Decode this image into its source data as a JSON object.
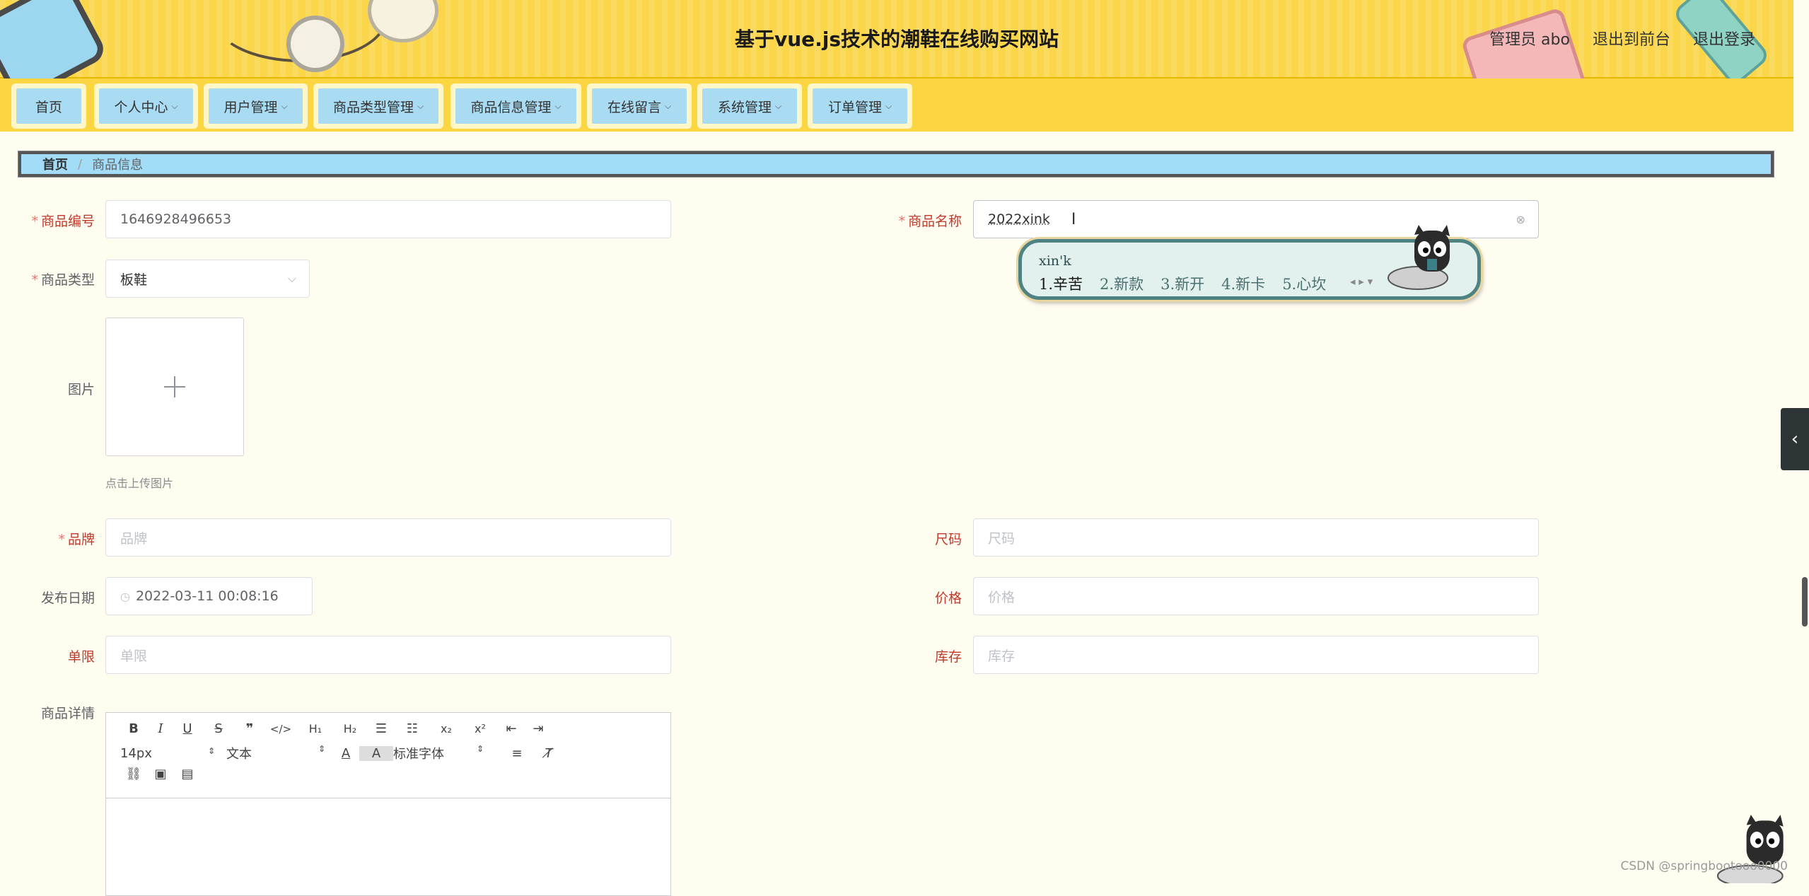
{
  "header": {
    "site_title": "基于vue.js技术的潮鞋在线购买网站",
    "admin_label": "管理员 abo",
    "to_front": "退出到前台",
    "logout": "退出登录"
  },
  "nav": {
    "items": [
      {
        "label": "首页"
      },
      {
        "label": "个人中心"
      },
      {
        "label": "用户管理"
      },
      {
        "label": "商品类型管理"
      },
      {
        "label": "商品信息管理"
      },
      {
        "label": "在线留言"
      },
      {
        "label": "系统管理"
      },
      {
        "label": "订单管理"
      }
    ],
    "caret": "⌵"
  },
  "breadcrumb": {
    "home": "首页",
    "sep": "/",
    "current": "商品信息"
  },
  "form": {
    "code": {
      "label": "商品编号",
      "value": "1646928496653"
    },
    "name": {
      "label": "商品名称",
      "value": "2022xink"
    },
    "type": {
      "label": "商品类型",
      "value": "板鞋"
    },
    "image": {
      "label": "图片",
      "hint": "点击上传图片"
    },
    "brand": {
      "label": "品牌",
      "placeholder": "品牌"
    },
    "size": {
      "label": "尺码",
      "placeholder": "尺码"
    },
    "date": {
      "label": "发布日期",
      "value": "2022-03-11 00:08:16"
    },
    "price": {
      "label": "价格",
      "placeholder": "价格"
    },
    "limit": {
      "label": "单限",
      "placeholder": "单限"
    },
    "stock": {
      "label": "库存",
      "placeholder": "库存"
    },
    "detail": {
      "label": "商品详情"
    }
  },
  "ime": {
    "composition": "xin'k",
    "candidates": [
      "1.辛苦",
      "2.新款",
      "3.新开",
      "4.新卡",
      "5.心坎"
    ]
  },
  "editor": {
    "font_size": "14px",
    "block": "文本",
    "font_family": "标准字体"
  },
  "watermark": "CSDN @springbootooo0000"
}
